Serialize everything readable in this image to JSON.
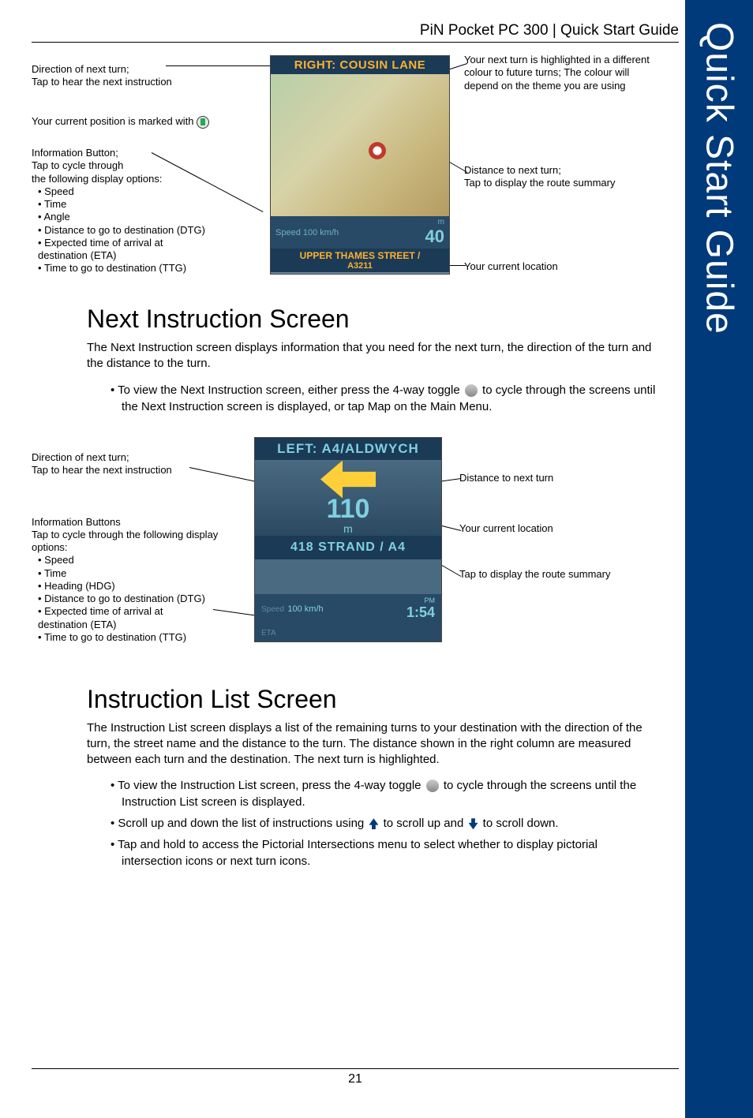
{
  "sideTab": "Quick Start Guide",
  "header": "PiN Pocket PC 300 | Quick Start Guide",
  "pageNumber": "21",
  "fig1": {
    "banner": "RIGHT: COUSIN LANE",
    "infoLeftLabel": "Speed",
    "infoLeftValue": "100 km/h",
    "infoRightUnit": "m",
    "infoRightValue": "40",
    "locLine1": "UPPER THAMES STREET /",
    "locLine2": "A3211",
    "callouts": {
      "directionTurn": "Direction of next turn;\nTap to hear the next instruction",
      "currentPos": "Your current position is marked with",
      "infoButtonTitle": "Information Button;\nTap to cycle through\nthe following display options:",
      "infoOptions": [
        "Speed",
        "Time",
        "Angle",
        "Distance to go to destination (DTG)",
        "Expected time of arrival at\n  destination (ETA)",
        "Time to go to destination (TTG)"
      ],
      "nextTurnHighlight": "Your next turn is highlighted in a different colour to future turns; The colour will depend on the theme you are using",
      "distanceNext": "Distance to next turn;\nTap to display the route summary",
      "currentLoc": "Your current location"
    }
  },
  "section1": {
    "title": "Next Instruction Screen",
    "body": "The Next Instruction screen displays information that you need for the next turn, the direction of the turn and the distance to the turn.",
    "inst1a": "To view the Next Instruction screen, either press the 4-way toggle ",
    "inst1b": " to cycle through the screens until the Next Instruction screen is displayed, or tap Map on the Main Menu."
  },
  "fig2": {
    "banner": "LEFT: A4/ALDWYCH",
    "distance": "110",
    "distUnit": "m",
    "loc": "418 STRAND / A4",
    "speedLabel": "Speed",
    "speedValue": "100 km/h",
    "timePM": "PM",
    "timeValue": "1:54",
    "etaLabel": "ETA",
    "callouts": {
      "directionTurn": "Direction of next turn;\nTap to hear the next instruction",
      "infoButtonsTitle": "Information Buttons\nTap to cycle through the following display options:",
      "infoOptions": [
        "Speed",
        "Time",
        "Heading (HDG)",
        "Distance to go to destination (DTG)",
        "Expected time of arrival at\n  destination (ETA)",
        "Time to go to destination (TTG)"
      ],
      "distanceNext": "Distance to next turn",
      "currentLoc": "Your current location",
      "routeSummary": "Tap to display the route summary"
    }
  },
  "section2": {
    "title": "Instruction List Screen",
    "body": "The Instruction List screen displays a list of the remaining turns to your destination with the direction of the turn, the street name and the distance to the turn. The distance shown in the right column are measured between each turn and the destination. The next turn is highlighted.",
    "inst1a": "To view the Instruction List screen, press the 4-way toggle ",
    "inst1b": " to cycle through the screens until the Instruction List screen is displayed.",
    "inst2a": "Scroll up and down the list of instructions using ",
    "inst2b": " to scroll up and ",
    "inst2c": " to scroll down.",
    "inst3": "Tap and hold to access the Pictorial Intersections menu to select whether to display pictorial intersection icons or next turn icons."
  }
}
